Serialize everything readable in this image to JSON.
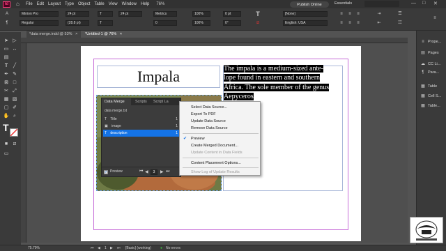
{
  "menu": {
    "app_badge": "Id",
    "items": [
      "File",
      "Edit",
      "Layout",
      "Type",
      "Object",
      "Table",
      "View",
      "Window",
      "Help"
    ],
    "zoom": "76%",
    "publish_label": "Publish Online",
    "workspace": "Essentials",
    "window_controls": [
      "—",
      "□",
      "✕"
    ]
  },
  "control_panel": {
    "font_family": "Minion Pro",
    "font_style": "Regular",
    "font_size": "24 pt",
    "leading": "(28.8 pt)",
    "kerning": "Metrics",
    "tracking": "0",
    "h_scale": "100%",
    "v_scale": "100%",
    "baseline": "0 pt",
    "skew": "0°",
    "char_style": "[None]",
    "language": "English: USA"
  },
  "tabs": [
    {
      "label": "*data merge.indd @ 53%",
      "close": "×"
    },
    {
      "label": "*Untitled-1 @ 76%",
      "close": "×"
    }
  ],
  "document": {
    "title_text": "Impala",
    "description_lines": [
      "The impala is a medium-sized ante-",
      "lope found in eastern and southern",
      "Africa. The sole member of the genus",
      "Aepyceros"
    ]
  },
  "data_merge": {
    "tabs": [
      "Data Merge",
      "Scripts",
      "Script La"
    ],
    "source_file": "data merge.txt",
    "fields": [
      {
        "icon": "T",
        "name": "Title",
        "count": "1"
      },
      {
        "icon": "▣",
        "name": "image",
        "count": "1"
      },
      {
        "icon": "T",
        "name": "description",
        "count": "1"
      }
    ],
    "preview_label": "Preview",
    "record_number": "3"
  },
  "flyout_menu": {
    "items": [
      {
        "label": "Select Data Source...",
        "enabled": true
      },
      {
        "label": "Export To PDF",
        "enabled": true
      },
      {
        "label": "Update Data Source",
        "enabled": true
      },
      {
        "label": "Remove Data Source",
        "enabled": true
      },
      {
        "label": "Preview",
        "enabled": true,
        "checked": true
      },
      {
        "label": "Create Merged Document...",
        "enabled": true
      },
      {
        "label": "Update Content in Data Fields",
        "enabled": false
      },
      {
        "label": "Content Placement Options...",
        "enabled": true
      },
      {
        "label": "Show Log of Update Results",
        "enabled": false
      }
    ]
  },
  "dock": [
    {
      "icon": "≡",
      "label": "Prope..."
    },
    {
      "icon": "▤",
      "label": "Pages"
    },
    {
      "icon": "☁",
      "label": "CC Li..."
    },
    {
      "icon": "¶",
      "label": "Para..."
    },
    {
      "icon": "▦",
      "label": "Table"
    },
    {
      "icon": "▦",
      "label": "Cell S..."
    },
    {
      "icon": "▦",
      "label": "Table..."
    }
  ],
  "status_bar": {
    "zoom": "75.79%",
    "page": "1",
    "style": "[Basic] (working)",
    "errors": "No errors"
  },
  "colors": {
    "accent": "#1473e6",
    "brand": "#ff3b7c",
    "margin_guide": "#c76dd8",
    "frame_edge": "#a9b8d8"
  }
}
